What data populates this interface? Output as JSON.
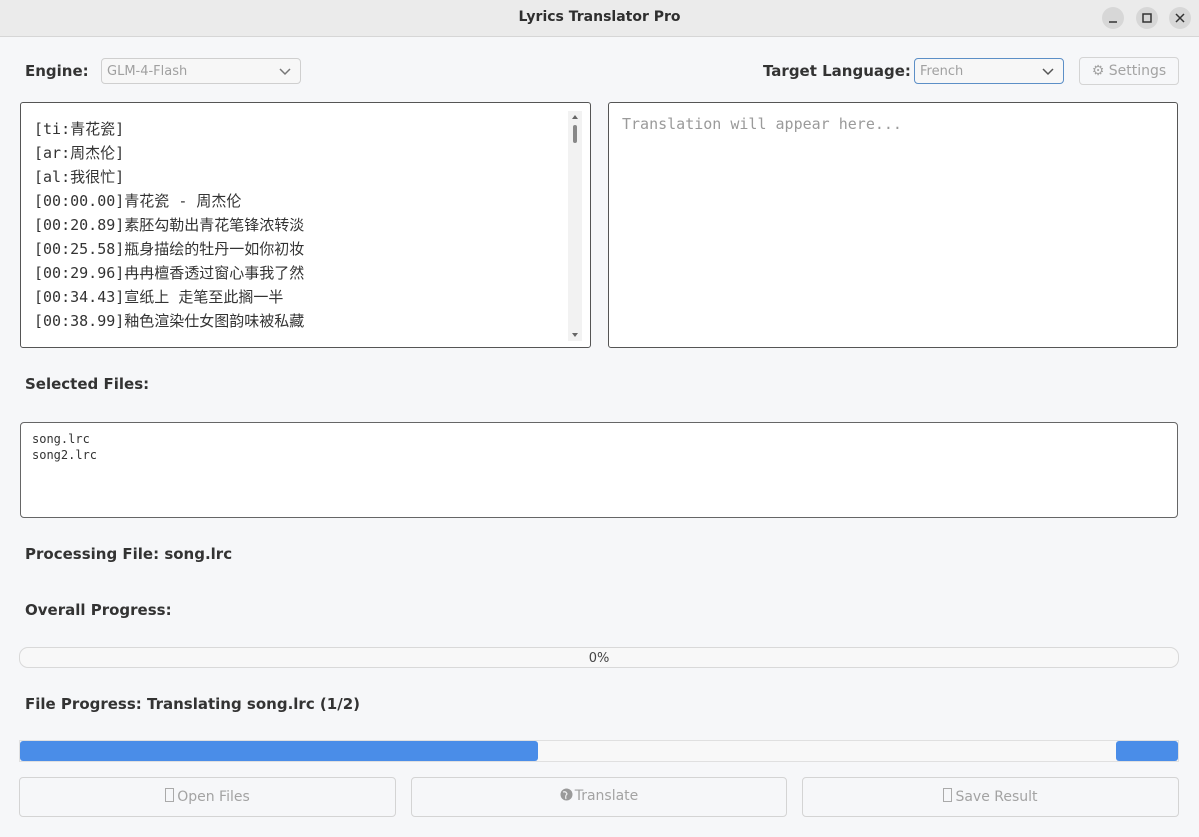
{
  "window": {
    "title": "Lyrics Translator Pro"
  },
  "toolbar": {
    "engine_label": "Engine:",
    "engine_value": "GLM-4-Flash",
    "target_label": "Target Language:",
    "target_value": "French",
    "settings_label": "⚙ Settings"
  },
  "source": {
    "lines": [
      "[ti:青花瓷]",
      "[ar:周杰伦]",
      "[al:我很忙]",
      "[00:00.00]青花瓷 - 周杰伦",
      "[00:20.89]素胚勾勒出青花笔锋浓转淡",
      "[00:25.58]瓶身描绘的牡丹一如你初妆",
      "[00:29.96]冉冉檀香透过窗心事我了然",
      "[00:34.43]宣纸上 走笔至此搁一半",
      "[00:38.99]釉色渲染仕女图韵味被私藏"
    ]
  },
  "translation": {
    "placeholder": "Translation will appear here..."
  },
  "files": {
    "label": "Selected Files:",
    "items": [
      "song.lrc",
      "song2.lrc"
    ]
  },
  "status": {
    "processing": "Processing File: song.lrc",
    "overall_label": "Overall Progress:",
    "overall_text": "0%",
    "overall_fraction": 0,
    "file_progress": "File Progress: Translating song.lrc (1/2)"
  },
  "actions": {
    "open": "Open Files",
    "translate": "Translate",
    "save": "Save Result"
  },
  "colors": {
    "accent": "#4a8de8",
    "focus_border": "#5c8fc7"
  }
}
